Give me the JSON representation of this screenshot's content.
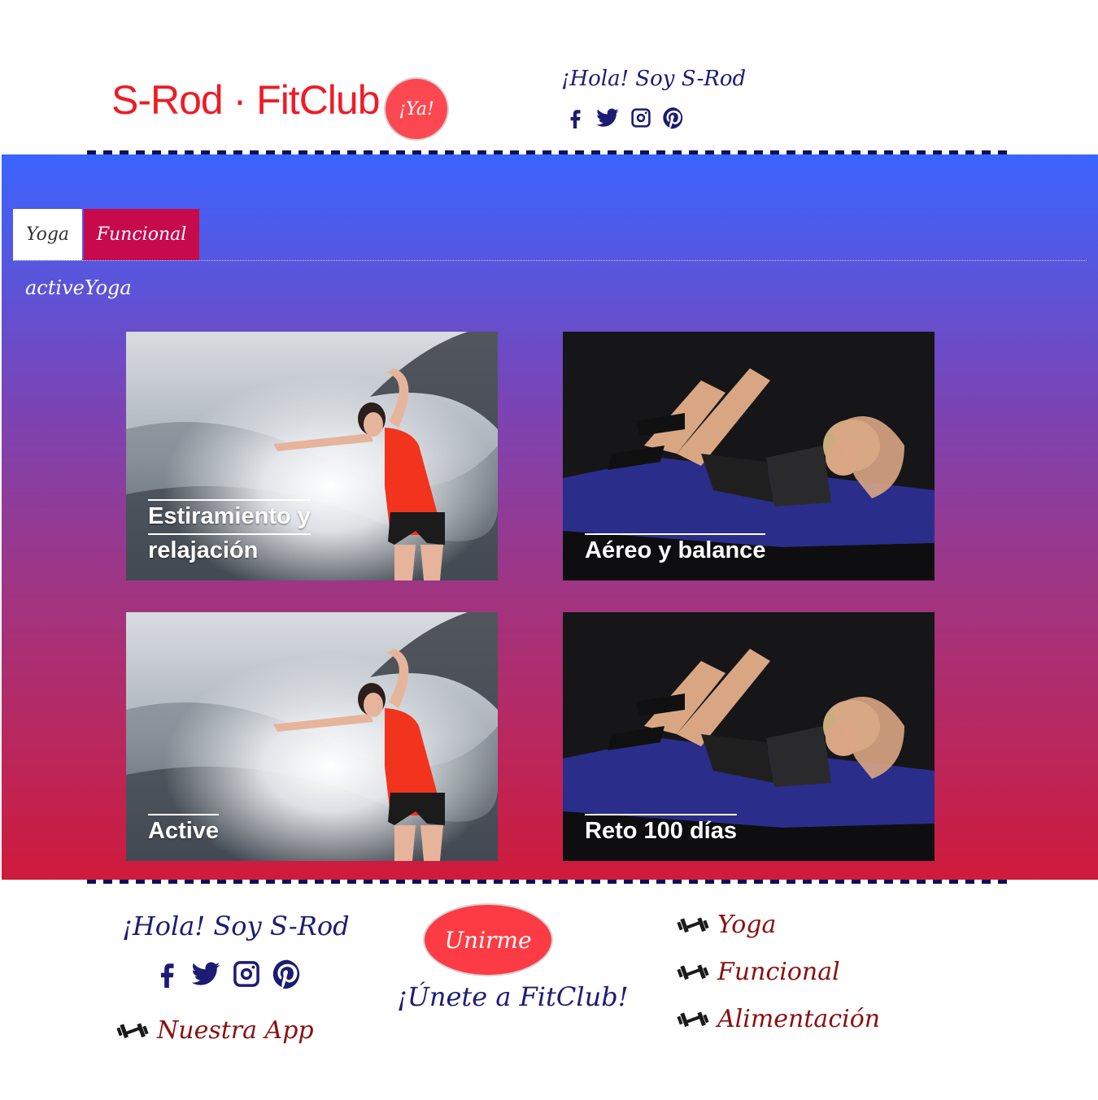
{
  "header": {
    "brand": "S-Rod · FitClub",
    "badge": "¡Ya!",
    "greeting": "¡Hola! Soy S-Rod"
  },
  "social": [
    "facebook-icon",
    "twitter-icon",
    "instagram-icon",
    "pinterest-icon"
  ],
  "tabs": [
    {
      "label": "Yoga",
      "active": true
    },
    {
      "label": "Funcional",
      "active": false
    }
  ],
  "active_text": "activeYoga",
  "cards": [
    {
      "lines": [
        "Estiramiento y",
        "relajación"
      ],
      "image": "woman-stretching"
    },
    {
      "lines": [
        "Aéreo y balance"
      ],
      "image": "woman-crunches"
    },
    {
      "lines": [
        "Active"
      ],
      "image": "woman-stretching"
    },
    {
      "lines": [
        "Reto 100 días"
      ],
      "image": "woman-crunches"
    }
  ],
  "footer": {
    "greeting": "¡Hola! Soy S-Rod",
    "app_link": "Nuestra App",
    "join_button": "Unirme",
    "join_text": "¡Únete a FitClub!",
    "links": [
      "Yoga",
      "Funcional",
      "Alimentación"
    ]
  },
  "colors": {
    "brand": "#ee1c25",
    "navy": "#1c1c74",
    "link": "#8b0f0f",
    "badge": "#fd4751",
    "tab_active_bg": "#c70a4b",
    "gradient_top": "#3a64ff",
    "gradient_bottom": "#cf1b3c"
  }
}
